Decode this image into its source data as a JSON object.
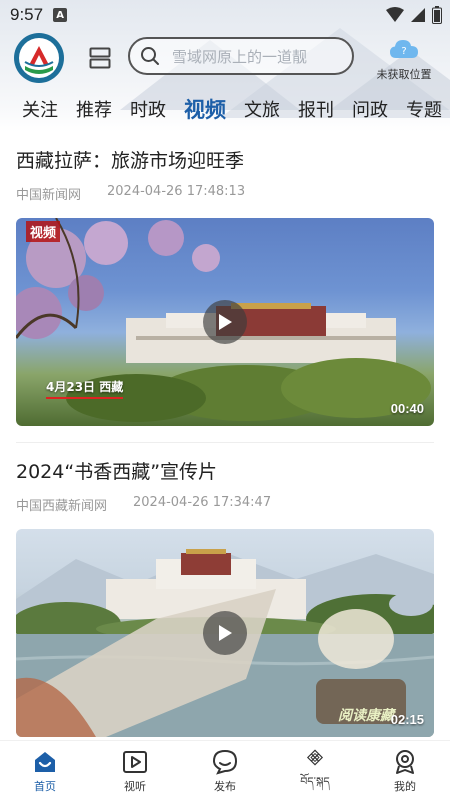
{
  "status_bar": {
    "time": "9:57",
    "notification": "A"
  },
  "header": {
    "search_placeholder": "雪域网原上的一道靓",
    "location_label": "未获取位置",
    "location_icon": "cloud-question-icon"
  },
  "tabs": [
    {
      "label": "关注",
      "active": false
    },
    {
      "label": "推荐",
      "active": false
    },
    {
      "label": "时政",
      "active": false
    },
    {
      "label": "视频",
      "active": true
    },
    {
      "label": "文旅",
      "active": false
    },
    {
      "label": "报刊",
      "active": false
    },
    {
      "label": "问政",
      "active": false
    },
    {
      "label": "专题",
      "active": false
    }
  ],
  "articles": [
    {
      "title": "西藏拉萨：旅游市场迎旺季",
      "source": "中国新闻网",
      "time": "2024-04-26 17:48:13",
      "duration": "00:40",
      "badge": "视频",
      "caption": "4月23日  西藏"
    },
    {
      "title": "2024“书香西藏”宣传片",
      "source": "中国西藏新闻网",
      "time": "2024-04-26 17:34:47",
      "duration": "02:15",
      "watermark": "阅读康藏"
    }
  ],
  "bottom_nav": [
    {
      "label": "首页",
      "icon": "home-icon",
      "active": true
    },
    {
      "label": "视听",
      "icon": "play-square-icon",
      "active": false
    },
    {
      "label": "发布",
      "icon": "chat-bubble-icon",
      "active": false
    },
    {
      "label": "བོད་སྐད",
      "icon": "endless-knot-icon",
      "active": false
    },
    {
      "label": "我的",
      "icon": "profile-icon",
      "active": false
    }
  ],
  "colors": {
    "accent": "#1d5fa8",
    "logo_blue": "#1d6f9a",
    "logo_red": "#d62a2a",
    "text": "#222222",
    "meta": "#999999"
  }
}
